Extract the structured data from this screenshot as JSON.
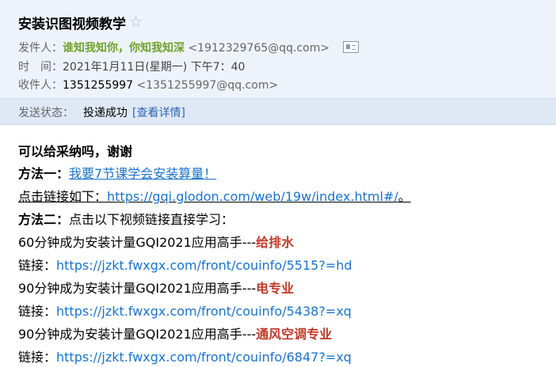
{
  "header": {
    "subject": "安装识图视频教学",
    "star_icon": "☆",
    "from_label": "发件人：",
    "from_name": "谁知我知你，你知我知深",
    "from_addr": "<1912329765@qq.com>",
    "time_label": "时　间：",
    "time_value": "2021年1月11日(星期一) 下午7：40",
    "to_label": "收件人：",
    "to_name": "1351255997",
    "to_addr": "<1351255997@qq.com>"
  },
  "status": {
    "label": "发送状态：",
    "value": "投递成功",
    "link": "[查看详情]"
  },
  "body": {
    "line1": "可以给采纳吗，谢谢",
    "method1_label": "方法一：",
    "method1_link": "我要7节课学会安装算量！",
    "click_text": "点击链接如下：",
    "click_url": "https://gqi.glodon.com/web/19w/index.html#/",
    "click_end": "。",
    "method2_label": "方法二：",
    "method2_text": "点击以下视频链接直接学习：",
    "course1_text": "60分钟成为安装计量GQI2021应用高手---",
    "course1_topic": "给排水",
    "link_label": "链接：",
    "course1_url": "https://jzkt.fwxgx.com/front/couinfo/5515?=hd",
    "course2_text": "90分钟成为安装计量GQI2021应用高手---",
    "course2_topic": "电专业",
    "course2_url": "https://jzkt.fwxgx.com/front/couinfo/5438?=xq",
    "course3_text": "90分钟成为安装计量GQI2021应用高手---",
    "course3_topic": "通风空调专业",
    "course3_url": "https://jzkt.fwxgx.com/front/couinfo/6847?=xq"
  },
  "colors": {
    "sender": "#6fa22c",
    "link": "#1a73c9",
    "topic": "#c0392b"
  }
}
